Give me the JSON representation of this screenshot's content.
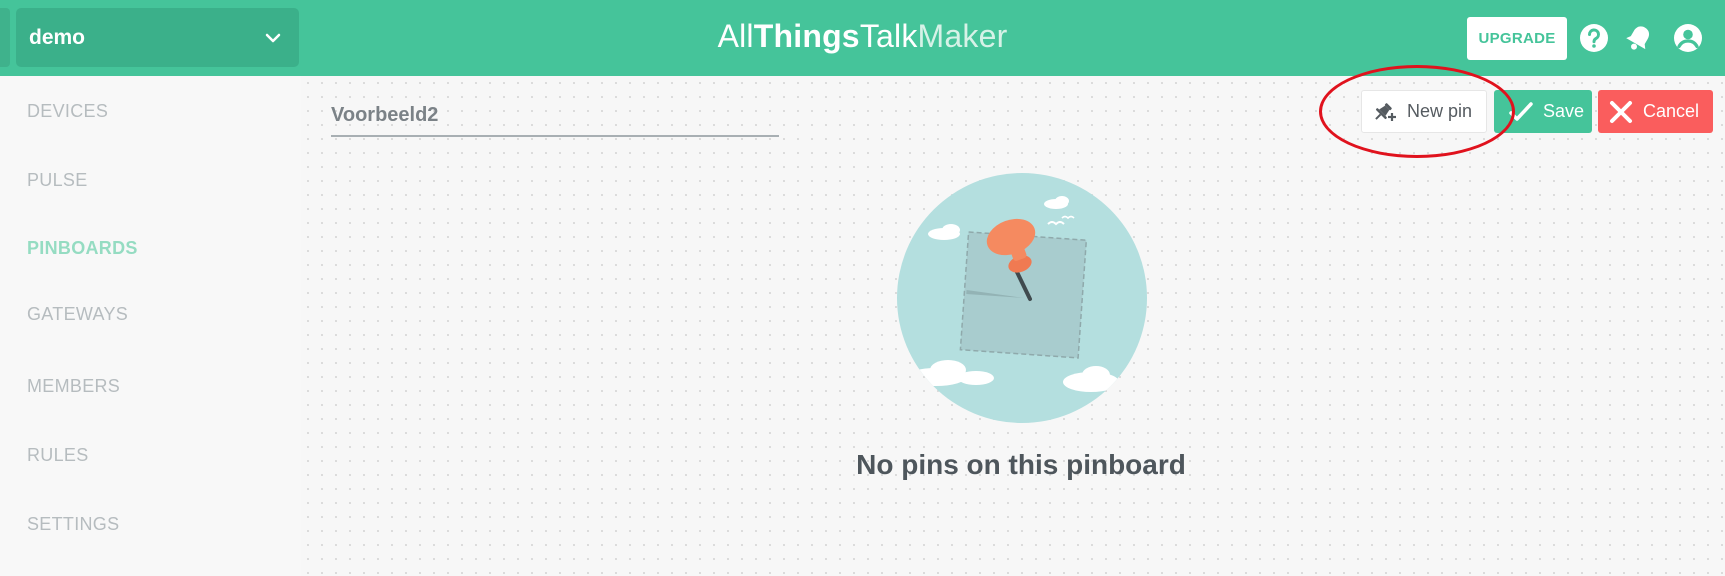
{
  "header": {
    "workspace": "demo",
    "brand": {
      "part1": "All",
      "part2": "Things",
      "part3": "Talk",
      "part4": "Maker"
    },
    "upgrade_label": "UPGRADE",
    "icons": [
      "help-icon",
      "notifications-bell-icon",
      "account-icon"
    ]
  },
  "sidebar": {
    "items": [
      {
        "label": "DEVICES",
        "active": false
      },
      {
        "label": "PULSE",
        "active": false
      },
      {
        "label": "PINBOARDS",
        "active": true
      },
      {
        "label": "GATEWAYS",
        "active": false
      },
      {
        "label": "MEMBERS",
        "active": false
      },
      {
        "label": "RULES",
        "active": false
      },
      {
        "label": "SETTINGS",
        "active": false
      }
    ]
  },
  "main": {
    "pinboard_name": "Voorbeeld2",
    "actions": {
      "new_pin_label": "New pin",
      "save_label": "Save",
      "cancel_label": "Cancel"
    },
    "empty_state_text": "No pins on this pinboard"
  },
  "colors": {
    "brand_green": "#45c49a",
    "cancel_red": "#fa5d5d",
    "annotation_ring": "#e0121d"
  }
}
